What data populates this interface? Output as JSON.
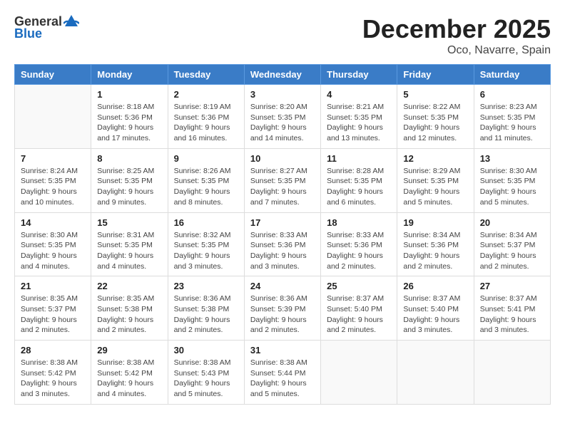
{
  "header": {
    "logo_general": "General",
    "logo_blue": "Blue",
    "month_title": "December 2025",
    "location": "Oco, Navarre, Spain"
  },
  "calendar": {
    "days_of_week": [
      "Sunday",
      "Monday",
      "Tuesday",
      "Wednesday",
      "Thursday",
      "Friday",
      "Saturday"
    ],
    "weeks": [
      [
        {
          "day": "",
          "info": ""
        },
        {
          "day": "1",
          "info": "Sunrise: 8:18 AM\nSunset: 5:36 PM\nDaylight: 9 hours\nand 17 minutes."
        },
        {
          "day": "2",
          "info": "Sunrise: 8:19 AM\nSunset: 5:36 PM\nDaylight: 9 hours\nand 16 minutes."
        },
        {
          "day": "3",
          "info": "Sunrise: 8:20 AM\nSunset: 5:35 PM\nDaylight: 9 hours\nand 14 minutes."
        },
        {
          "day": "4",
          "info": "Sunrise: 8:21 AM\nSunset: 5:35 PM\nDaylight: 9 hours\nand 13 minutes."
        },
        {
          "day": "5",
          "info": "Sunrise: 8:22 AM\nSunset: 5:35 PM\nDaylight: 9 hours\nand 12 minutes."
        },
        {
          "day": "6",
          "info": "Sunrise: 8:23 AM\nSunset: 5:35 PM\nDaylight: 9 hours\nand 11 minutes."
        }
      ],
      [
        {
          "day": "7",
          "info": "Sunrise: 8:24 AM\nSunset: 5:35 PM\nDaylight: 9 hours\nand 10 minutes."
        },
        {
          "day": "8",
          "info": "Sunrise: 8:25 AM\nSunset: 5:35 PM\nDaylight: 9 hours\nand 9 minutes."
        },
        {
          "day": "9",
          "info": "Sunrise: 8:26 AM\nSunset: 5:35 PM\nDaylight: 9 hours\nand 8 minutes."
        },
        {
          "day": "10",
          "info": "Sunrise: 8:27 AM\nSunset: 5:35 PM\nDaylight: 9 hours\nand 7 minutes."
        },
        {
          "day": "11",
          "info": "Sunrise: 8:28 AM\nSunset: 5:35 PM\nDaylight: 9 hours\nand 6 minutes."
        },
        {
          "day": "12",
          "info": "Sunrise: 8:29 AM\nSunset: 5:35 PM\nDaylight: 9 hours\nand 5 minutes."
        },
        {
          "day": "13",
          "info": "Sunrise: 8:30 AM\nSunset: 5:35 PM\nDaylight: 9 hours\nand 5 minutes."
        }
      ],
      [
        {
          "day": "14",
          "info": "Sunrise: 8:30 AM\nSunset: 5:35 PM\nDaylight: 9 hours\nand 4 minutes."
        },
        {
          "day": "15",
          "info": "Sunrise: 8:31 AM\nSunset: 5:35 PM\nDaylight: 9 hours\nand 4 minutes."
        },
        {
          "day": "16",
          "info": "Sunrise: 8:32 AM\nSunset: 5:35 PM\nDaylight: 9 hours\nand 3 minutes."
        },
        {
          "day": "17",
          "info": "Sunrise: 8:33 AM\nSunset: 5:36 PM\nDaylight: 9 hours\nand 3 minutes."
        },
        {
          "day": "18",
          "info": "Sunrise: 8:33 AM\nSunset: 5:36 PM\nDaylight: 9 hours\nand 2 minutes."
        },
        {
          "day": "19",
          "info": "Sunrise: 8:34 AM\nSunset: 5:36 PM\nDaylight: 9 hours\nand 2 minutes."
        },
        {
          "day": "20",
          "info": "Sunrise: 8:34 AM\nSunset: 5:37 PM\nDaylight: 9 hours\nand 2 minutes."
        }
      ],
      [
        {
          "day": "21",
          "info": "Sunrise: 8:35 AM\nSunset: 5:37 PM\nDaylight: 9 hours\nand 2 minutes."
        },
        {
          "day": "22",
          "info": "Sunrise: 8:35 AM\nSunset: 5:38 PM\nDaylight: 9 hours\nand 2 minutes."
        },
        {
          "day": "23",
          "info": "Sunrise: 8:36 AM\nSunset: 5:38 PM\nDaylight: 9 hours\nand 2 minutes."
        },
        {
          "day": "24",
          "info": "Sunrise: 8:36 AM\nSunset: 5:39 PM\nDaylight: 9 hours\nand 2 minutes."
        },
        {
          "day": "25",
          "info": "Sunrise: 8:37 AM\nSunset: 5:40 PM\nDaylight: 9 hours\nand 2 minutes."
        },
        {
          "day": "26",
          "info": "Sunrise: 8:37 AM\nSunset: 5:40 PM\nDaylight: 9 hours\nand 3 minutes."
        },
        {
          "day": "27",
          "info": "Sunrise: 8:37 AM\nSunset: 5:41 PM\nDaylight: 9 hours\nand 3 minutes."
        }
      ],
      [
        {
          "day": "28",
          "info": "Sunrise: 8:38 AM\nSunset: 5:42 PM\nDaylight: 9 hours\nand 3 minutes."
        },
        {
          "day": "29",
          "info": "Sunrise: 8:38 AM\nSunset: 5:42 PM\nDaylight: 9 hours\nand 4 minutes."
        },
        {
          "day": "30",
          "info": "Sunrise: 8:38 AM\nSunset: 5:43 PM\nDaylight: 9 hours\nand 5 minutes."
        },
        {
          "day": "31",
          "info": "Sunrise: 8:38 AM\nSunset: 5:44 PM\nDaylight: 9 hours\nand 5 minutes."
        },
        {
          "day": "",
          "info": ""
        },
        {
          "day": "",
          "info": ""
        },
        {
          "day": "",
          "info": ""
        }
      ]
    ]
  }
}
